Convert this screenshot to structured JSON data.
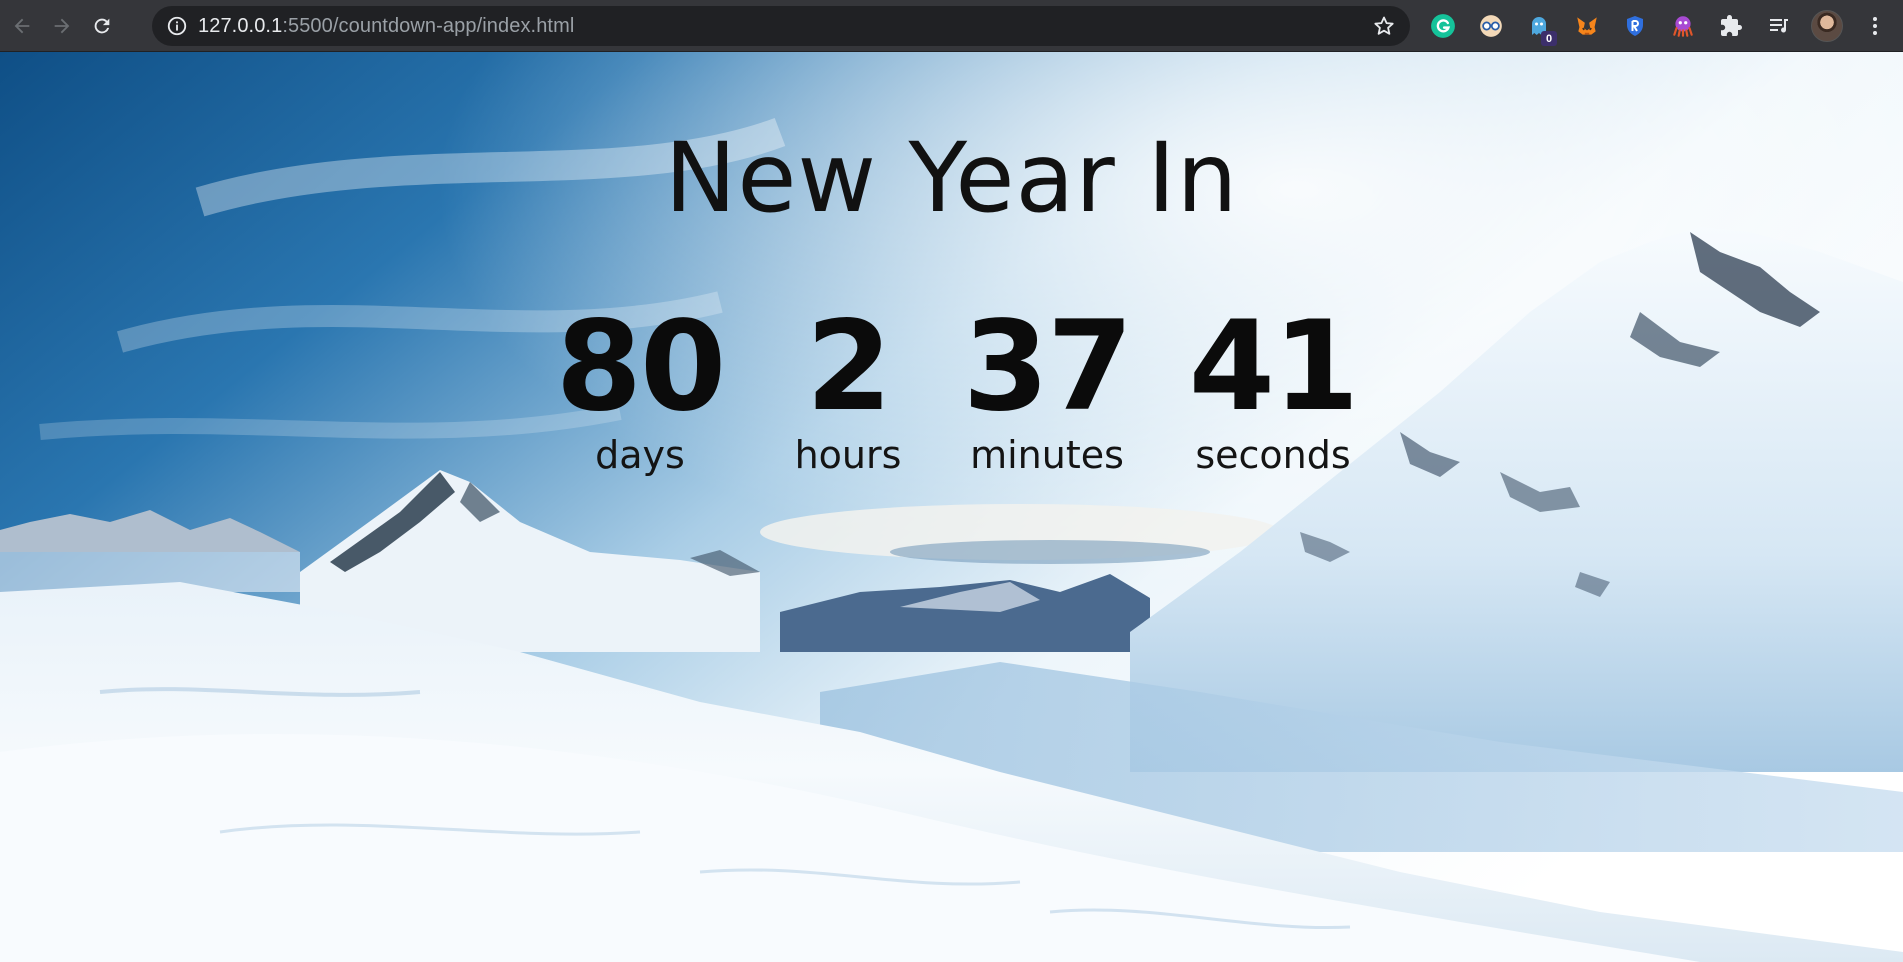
{
  "browser": {
    "url_host": "127.0.0.1",
    "url_rest": ":5500/countdown-app/index.html",
    "extensions": [
      {
        "name": "grammarly-extension-icon",
        "color": "#15c39a"
      },
      {
        "name": "reader-extension-icon",
        "color": "#4a90d9"
      },
      {
        "name": "ghost-extension-icon",
        "color": "#4ea8de",
        "badge": "0"
      },
      {
        "name": "metamask-extension-icon",
        "color": "#f6851b"
      },
      {
        "name": "shield-extension-icon",
        "color": "#2f6fde"
      },
      {
        "name": "octopus-extension-icon",
        "color": "#a84ad3"
      }
    ]
  },
  "page": {
    "title": "New Year In",
    "countdown": {
      "days": "80",
      "days_label": "days",
      "hours": "2",
      "hours_label": "hours",
      "minutes": "37",
      "minutes_label": "minutes",
      "seconds": "41",
      "seconds_label": "seconds"
    }
  },
  "colors": {
    "toolbar": "#35363a",
    "omnibox": "#202124",
    "sky_deep": "#0f4f86",
    "snow": "#f4f8fb"
  }
}
